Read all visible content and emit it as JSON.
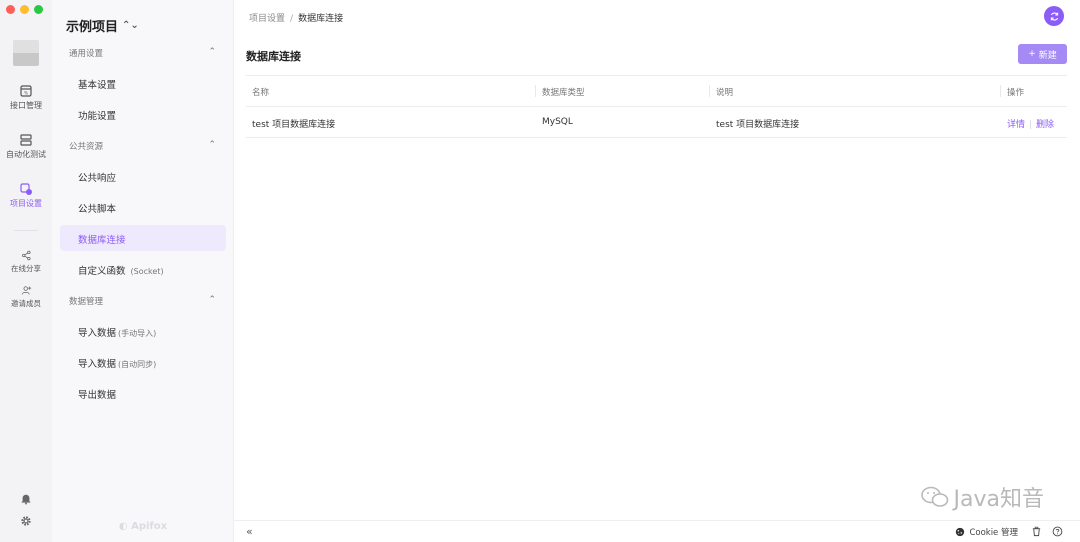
{
  "colors": {
    "accent": "#8b5cf6",
    "accent_light": "#efe9fd",
    "new_button": "#a58af5"
  },
  "rail": {
    "items": [
      {
        "label": "接口管理",
        "icon": "api-icon"
      },
      {
        "label": "自动化测试",
        "icon": "automation-icon"
      },
      {
        "label": "项目设置",
        "icon": "project-settings-icon"
      },
      {
        "label": "在线分享",
        "icon": "share-icon"
      },
      {
        "label": "邀请成员",
        "icon": "invite-member-icon"
      }
    ]
  },
  "sidebar": {
    "project_name": "示例项目",
    "groups": [
      {
        "label": "通用设置",
        "items": [
          {
            "label": "基本设置"
          },
          {
            "label": "功能设置"
          }
        ]
      },
      {
        "label": "公共资源",
        "items": [
          {
            "label": "公共响应"
          },
          {
            "label": "公共脚本"
          },
          {
            "label": "数据库连接"
          },
          {
            "label": "自定义函数",
            "sub": "(Socket)"
          }
        ]
      },
      {
        "label": "数据管理",
        "items": [
          {
            "label": "导入数据",
            "sub": "(手动导入)"
          },
          {
            "label": "导入数据",
            "sub": "(自动同步)"
          },
          {
            "label": "导出数据"
          }
        ]
      }
    ],
    "brand": "Apifox"
  },
  "main": {
    "breadcrumb": {
      "parent": "项目设置",
      "separator": "/",
      "current": "数据库连接"
    },
    "page_title": "数据库连接",
    "new_button": {
      "icon": "+",
      "label": "新建"
    },
    "table": {
      "columns": [
        "名称",
        "数据库类型",
        "说明",
        "操作"
      ],
      "rows": [
        {
          "name": "test 项目数据库连接",
          "type": "MySQL",
          "desc": "test 项目数据库连接",
          "actions": [
            "详情",
            "删除"
          ]
        }
      ]
    }
  },
  "bottombar": {
    "collapse": "«",
    "cookie_label": "Cookie 管理"
  },
  "watermark": {
    "text": "Java知音"
  }
}
